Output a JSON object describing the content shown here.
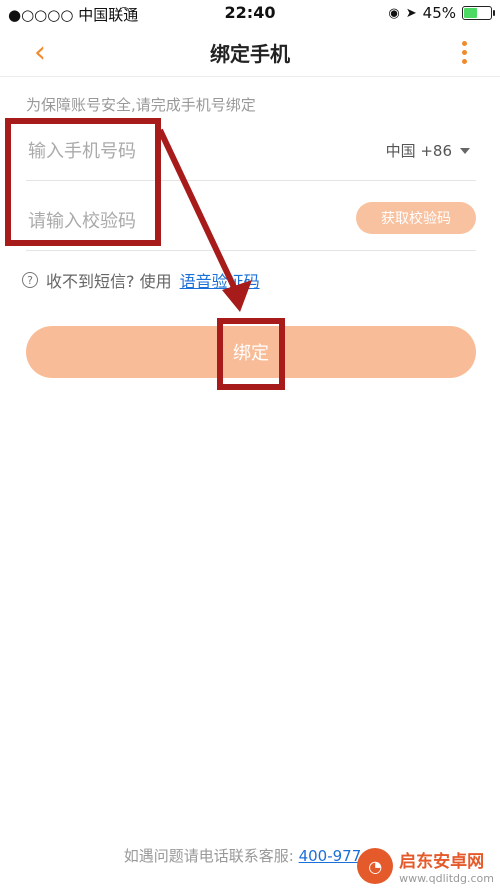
{
  "statusbar": {
    "carrier": "●○○○○ 中国联通",
    "time": "22:40",
    "battery": "45%",
    "battery_level": 0.45
  },
  "header": {
    "title": "绑定手机"
  },
  "hint": "为保障账号安全,请完成手机号绑定",
  "phone_field": {
    "placeholder": "输入手机号码",
    "value": ""
  },
  "country_code": {
    "label": "中国 +86"
  },
  "code_field": {
    "placeholder": "请输入校验码",
    "value": ""
  },
  "get_code_label": "获取校验码",
  "sms_help": {
    "text": "收不到短信? 使用",
    "link": "语音验证码"
  },
  "bind_label": "绑定",
  "footer": {
    "text": "如遇问题请电话联系客服:",
    "phone": "400-977-0"
  },
  "watermark": {
    "cn": "启东安卓网",
    "url": "www.qdlitdg.com"
  },
  "colors": {
    "accent": "#f08a2e",
    "button": "#f8bd98",
    "annotation": "#a81b1b",
    "link": "#1a6fd8"
  },
  "icons": [
    "chevron-left-icon",
    "more-vertical-icon",
    "wifi-icon",
    "location-icon",
    "caret-down-icon",
    "question-icon"
  ]
}
